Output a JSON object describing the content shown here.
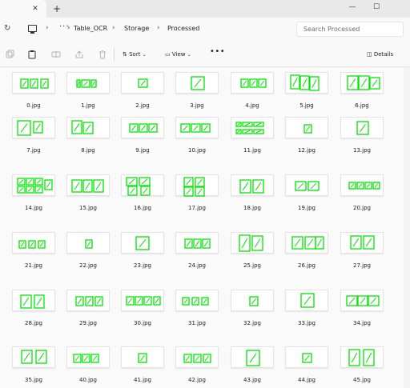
{
  "tab": {
    "close_icon": "close-icon",
    "new_tab_icon": "plus-icon"
  },
  "window": {
    "minimize_label": "—",
    "maximize_label": "☐"
  },
  "address": {
    "breadcrumbs": [
      "Table_OCR",
      "Storage",
      "Processed"
    ],
    "search_placeholder": "Search Processed"
  },
  "toolbar": {
    "sort_label": "Sort",
    "view_label": "View",
    "more_label": "•••",
    "details_label": "Details"
  },
  "colors": {
    "box_green": "#00e600",
    "background": "#fafafa"
  },
  "files": [
    "0.jpg",
    "1.jpg",
    "2.jpg",
    "3.jpg",
    "4.jpg",
    "5.jpg",
    "6.jpg",
    "7.jpg",
    "8.jpg",
    "9.jpg",
    "10.jpg",
    "11.jpg",
    "12.jpg",
    "13.jpg",
    "14.jpg",
    "15.jpg",
    "16.jpg",
    "17.jpg",
    "18.jpg",
    "19.jpg",
    "20.jpg",
    "21.jpg",
    "22.jpg",
    "23.jpg",
    "24.jpg",
    "25.jpg",
    "26.jpg",
    "27.jpg",
    "28.jpg",
    "29.jpg",
    "30.jpg",
    "31.jpg",
    "32.jpg",
    "33.jpg",
    "34.jpg",
    "35.jpg",
    "40.jpg",
    "41.jpg",
    "42.jpg",
    "43.jpg",
    "44.jpg",
    "45.jpg"
  ]
}
